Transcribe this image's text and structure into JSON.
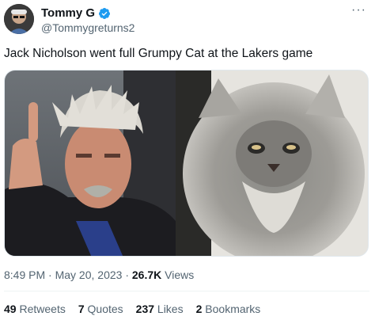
{
  "author": {
    "display_name": "Tommy G",
    "handle": "@Tommygreturns2",
    "verified": true
  },
  "tweet": {
    "text": "Jack Nicholson went full Grumpy Cat at the Lakers game",
    "time": "8:49 PM",
    "date": "May 20, 2023",
    "views_count": "26.7K",
    "views_label": "Views"
  },
  "stats": {
    "retweets": {
      "count": "49",
      "label": "Retweets"
    },
    "quotes": {
      "count": "7",
      "label": "Quotes"
    },
    "likes": {
      "count": "237",
      "label": "Likes"
    },
    "bookmarks": {
      "count": "2",
      "label": "Bookmarks"
    }
  },
  "icons": {
    "verified": "verified-badge-icon",
    "more": "more-options-icon"
  },
  "colors": {
    "text_primary": "#0f1419",
    "text_secondary": "#536471",
    "verified_blue": "#1d9bf0",
    "divider": "#eff3f4"
  }
}
